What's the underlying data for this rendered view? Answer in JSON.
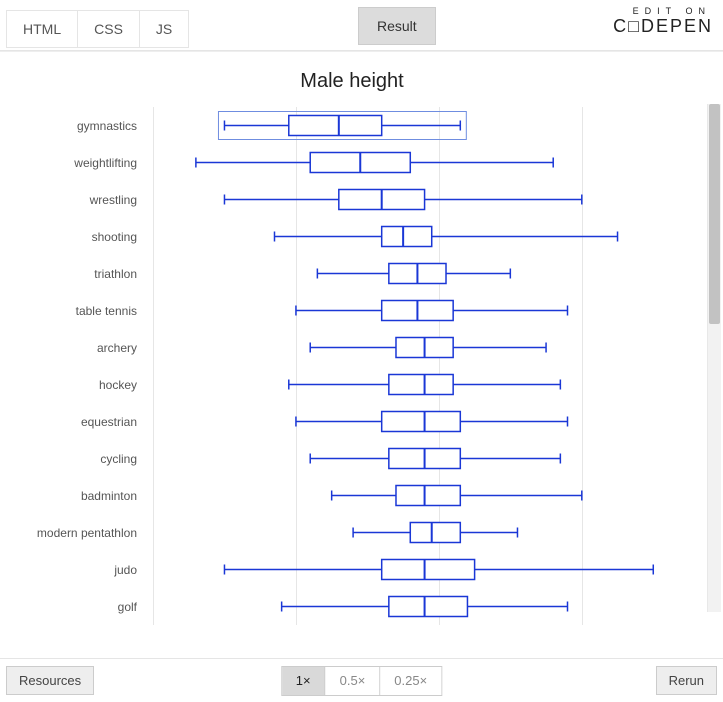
{
  "tabs": {
    "html": "HTML",
    "css": "CSS",
    "js": "JS",
    "result": "Result"
  },
  "editon": {
    "top": "EDIT ON",
    "logo": "C□DEPEN"
  },
  "bottombar": {
    "resources": "Resources",
    "rerun": "Rerun",
    "zoom": [
      "1×",
      "0.5×",
      "0.25×"
    ],
    "zoom_active": 0
  },
  "chart_data": {
    "type": "box",
    "title": "Male height",
    "xlabel": "",
    "ylabel": "",
    "xlim": [
      140,
      215
    ],
    "grid": true,
    "gridlines_x": [
      140,
      160,
      180,
      200
    ],
    "color": "#1a37d6",
    "series": [
      {
        "name": "gymnastics",
        "min": 150,
        "q1": 159,
        "median": 166,
        "q3": 172,
        "max": 183
      },
      {
        "name": "weightlifting",
        "min": 146,
        "q1": 162,
        "median": 169,
        "q3": 176,
        "max": 196
      },
      {
        "name": "wrestling",
        "min": 150,
        "q1": 166,
        "median": 172,
        "q3": 178,
        "max": 200
      },
      {
        "name": "shooting",
        "min": 157,
        "q1": 172,
        "median": 175,
        "q3": 179,
        "max": 205
      },
      {
        "name": "triathlon",
        "min": 163,
        "q1": 173,
        "median": 177,
        "q3": 181,
        "max": 190
      },
      {
        "name": "table tennis",
        "min": 160,
        "q1": 172,
        "median": 177,
        "q3": 182,
        "max": 198
      },
      {
        "name": "archery",
        "min": 162,
        "q1": 174,
        "median": 178,
        "q3": 182,
        "max": 195
      },
      {
        "name": "hockey",
        "min": 159,
        "q1": 173,
        "median": 178,
        "q3": 182,
        "max": 197
      },
      {
        "name": "equestrian",
        "min": 160,
        "q1": 172,
        "median": 178,
        "q3": 183,
        "max": 198
      },
      {
        "name": "cycling",
        "min": 162,
        "q1": 173,
        "median": 178,
        "q3": 183,
        "max": 197
      },
      {
        "name": "badminton",
        "min": 165,
        "q1": 174,
        "median": 178,
        "q3": 183,
        "max": 200
      },
      {
        "name": "modern pentathlon",
        "min": 168,
        "q1": 176,
        "median": 179,
        "q3": 183,
        "max": 191
      },
      {
        "name": "judo",
        "min": 150,
        "q1": 172,
        "median": 178,
        "q3": 185,
        "max": 210
      },
      {
        "name": "golf",
        "min": 158,
        "q1": 173,
        "median": 178,
        "q3": 184,
        "max": 198
      }
    ]
  }
}
